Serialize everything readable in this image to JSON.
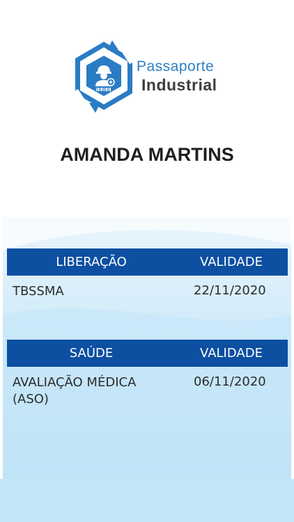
{
  "brand": {
    "line1": "Passaporte",
    "line2": "Industrial"
  },
  "person": {
    "name": "AMANDA MARTINS"
  },
  "sections": [
    {
      "title": "LIBERAÇÃO",
      "validity_label": "VALIDADE",
      "rows": [
        {
          "name": "TBSSMA",
          "date": "22/11/2020"
        }
      ]
    },
    {
      "title": "SAÚDE",
      "validity_label": "VALIDADE",
      "rows": [
        {
          "name": "AVALIAÇÃO MÉDICA (ASO)",
          "date": "06/11/2020"
        }
      ]
    }
  ],
  "colors": {
    "header_blue": "#0d4fa1",
    "brand_blue": "#2f7fc6",
    "background_light": "#c8e8f8"
  },
  "icons": [
    "passaporte-industrial-logo-icon",
    "worker-badge-icon"
  ]
}
